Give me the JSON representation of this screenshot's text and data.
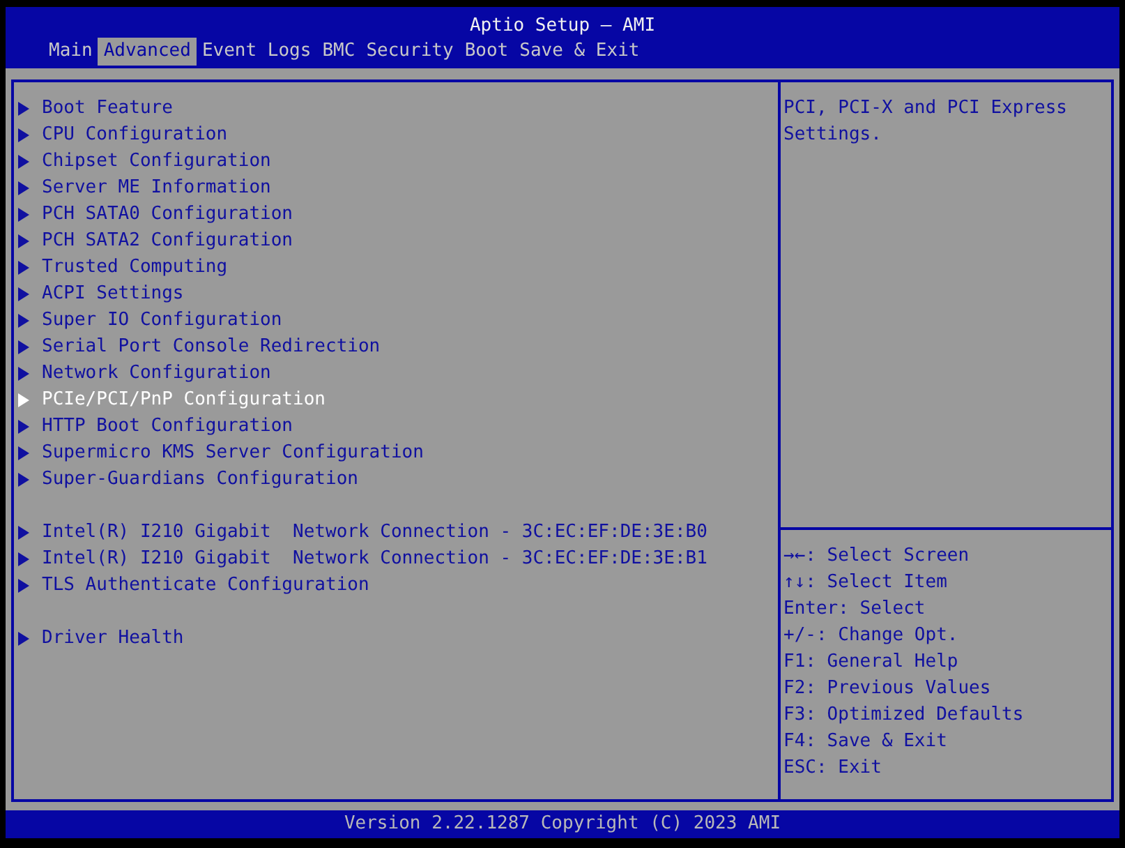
{
  "window": {
    "title": "Aptio Setup – AMI"
  },
  "tabs": [
    {
      "label": "Main",
      "selected": false
    },
    {
      "label": "Advanced",
      "selected": true
    },
    {
      "label": "Event Logs",
      "selected": false
    },
    {
      "label": "BMC",
      "selected": false
    },
    {
      "label": "Security",
      "selected": false
    },
    {
      "label": "Boot",
      "selected": false
    },
    {
      "label": "Save & Exit",
      "selected": false
    }
  ],
  "menu_groups": [
    [
      {
        "label": "Boot Feature",
        "selected": false
      },
      {
        "label": "CPU Configuration",
        "selected": false
      },
      {
        "label": "Chipset Configuration",
        "selected": false
      },
      {
        "label": "Server ME Information",
        "selected": false
      },
      {
        "label": "PCH SATA0 Configuration",
        "selected": false
      },
      {
        "label": "PCH SATA2 Configuration",
        "selected": false
      },
      {
        "label": "Trusted Computing",
        "selected": false
      },
      {
        "label": "ACPI Settings",
        "selected": false
      },
      {
        "label": "Super IO Configuration",
        "selected": false
      },
      {
        "label": "Serial Port Console Redirection",
        "selected": false
      },
      {
        "label": "Network Configuration",
        "selected": false
      },
      {
        "label": "PCIe/PCI/PnP Configuration",
        "selected": true
      },
      {
        "label": "HTTP Boot Configuration",
        "selected": false
      },
      {
        "label": "Supermicro KMS Server Configuration",
        "selected": false
      },
      {
        "label": "Super-Guardians Configuration",
        "selected": false
      }
    ],
    [
      {
        "label": "Intel(R) I210 Gigabit  Network Connection - 3C:EC:EF:DE:3E:B0",
        "selected": false
      },
      {
        "label": "Intel(R) I210 Gigabit  Network Connection - 3C:EC:EF:DE:3E:B1",
        "selected": false
      },
      {
        "label": "TLS Authenticate Configuration",
        "selected": false
      }
    ],
    [
      {
        "label": "Driver Health",
        "selected": false
      }
    ]
  ],
  "help_text": "PCI, PCI-X and PCI Express Settings.",
  "key_help": [
    "→←: Select Screen",
    "↑↓: Select Item",
    "Enter: Select",
    "+/-: Change Opt.",
    "F1: General Help",
    "F2: Previous Values",
    "F3: Optimized Defaults",
    "F4: Save & Exit",
    "ESC: Exit"
  ],
  "status_bar": "Version 2.22.1287 Copyright (C) 2023 AMI"
}
